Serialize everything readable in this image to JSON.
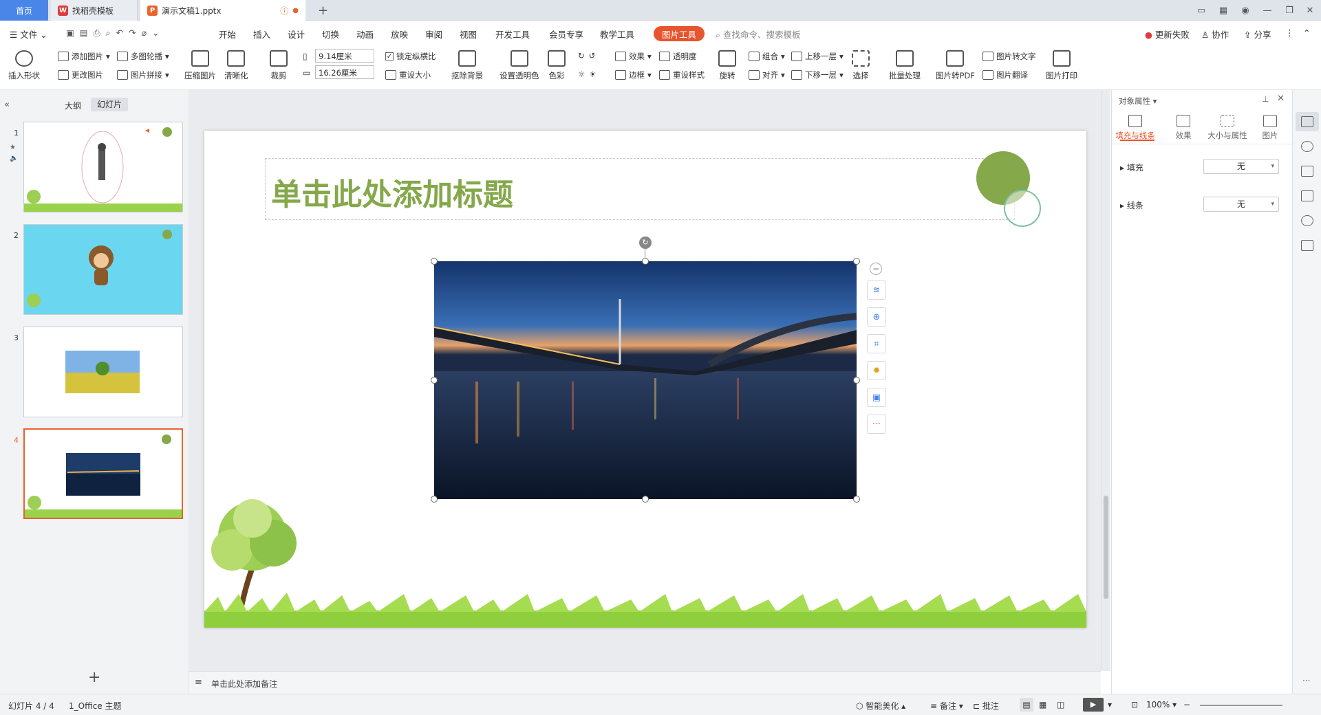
{
  "tabs": {
    "home": "首页",
    "template": "找稻壳模板",
    "doc": "演示文稿1.pptx",
    "new_tab": "+"
  },
  "menu": {
    "file": "文件",
    "items": [
      "开始",
      "插入",
      "设计",
      "切换",
      "动画",
      "放映",
      "审阅",
      "视图",
      "开发工具",
      "会员专享",
      "教学工具"
    ],
    "picture_tools": "图片工具",
    "search_placeholder": "查找命令、搜索模板",
    "update_failed": "更新失败",
    "collab": "协作",
    "share": "分享"
  },
  "ribbon": {
    "insert_shape": "插入形状",
    "add_picture": "添加图片",
    "change_picture": "更改图片",
    "multi_carousel": "多图轮播",
    "picture_splice": "图片拼接",
    "compress": "压缩图片",
    "sharpen": "清晰化",
    "crop": "裁剪",
    "width": "9.14厘米",
    "height": "16.26厘米",
    "lock_ratio": "锁定纵横比",
    "reset_size": "重设大小",
    "remove_bg": "抠除背景",
    "set_transparent": "设置透明色",
    "color": "色彩",
    "effects": "效果",
    "transparency": "透明度",
    "border": "边框",
    "reset_style": "重设样式",
    "rotate": "旋转",
    "group": "组合",
    "align": "对齐",
    "bring_forward": "上移一层",
    "send_backward": "下移一层",
    "select": "选择",
    "batch": "批量处理",
    "to_pdf": "图片转PDF",
    "to_text": "图片转文字",
    "translate": "图片翻译",
    "print": "图片打印"
  },
  "left_panel": {
    "outline": "大纲",
    "slides": "幻灯片",
    "numbers": [
      "1",
      "2",
      "3",
      "4"
    ]
  },
  "slide": {
    "title": "单击此处添加标题"
  },
  "notes": "单击此处添加备注",
  "right_panel": {
    "title": "对象属性",
    "tabs": [
      "填充与线条",
      "效果",
      "大小与属性",
      "图片"
    ],
    "fill_label": "填充",
    "fill_value": "无",
    "line_label": "线条",
    "line_value": "无"
  },
  "status": {
    "slide_count": "幻灯片 4 / 4",
    "theme": "1_Office 主题",
    "beautify": "智能美化",
    "notes": "备注",
    "comments": "批注",
    "zoom": "100%"
  },
  "colors": {
    "accent": "#e8542d",
    "title_green": "#84a84a",
    "home_blue": "#4a86e8"
  }
}
